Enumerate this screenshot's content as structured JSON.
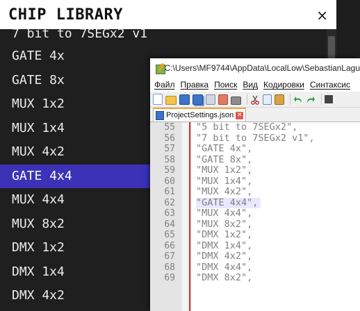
{
  "chip_library": {
    "title": "CHIP LIBRARY",
    "close_symbol": "×",
    "items": [
      {
        "label": "7 bit to 7SEGx2 v1",
        "selected": false
      },
      {
        "label": "GATE 4x",
        "selected": false
      },
      {
        "label": "GATE 8x",
        "selected": false
      },
      {
        "label": "MUX 1x2",
        "selected": false
      },
      {
        "label": "MUX 1x4",
        "selected": false
      },
      {
        "label": "MUX 4x2",
        "selected": false
      },
      {
        "label": "GATE 4x4",
        "selected": true
      },
      {
        "label": "MUX 4x4",
        "selected": false
      },
      {
        "label": "MUX 8x2",
        "selected": false
      },
      {
        "label": "DMX 1x2",
        "selected": false
      },
      {
        "label": "DMX 1x4",
        "selected": false
      },
      {
        "label": "DMX 4x2",
        "selected": false
      }
    ],
    "colors": {
      "selected_bg": "#3b32b8",
      "panel_bg": "#1f1f1f",
      "header_bg": "#ffffff"
    }
  },
  "editor_window": {
    "title": "C:\\Users\\MF9744\\AppData\\LocalLow\\SebastianLagu",
    "menu": [
      "Файл",
      "Правка",
      "Поиск",
      "Вид",
      "Кодировки",
      "Синтаксис"
    ],
    "toolbar_icons": [
      "new-file-icon",
      "open-file-icon",
      "save-icon",
      "save-all-icon",
      "close-icon",
      "close-all-icon",
      "print-icon",
      "cut-icon",
      "copy-icon",
      "paste-icon",
      "undo-icon",
      "redo-icon",
      "find-icon"
    ],
    "tab": {
      "label": "ProjectSettings.json",
      "close": "✕"
    },
    "current_line": 62,
    "lines": [
      {
        "number": "55",
        "text": "\"5 bit to 7SEGx2\","
      },
      {
        "number": "56",
        "text": "\"7 bit to 7SEGx2 v1\","
      },
      {
        "number": "57",
        "text": "\"GATE 4x\","
      },
      {
        "number": "58",
        "text": "\"GATE 8x\","
      },
      {
        "number": "59",
        "text": "\"MUX 1x2\","
      },
      {
        "number": "60",
        "text": "\"MUX 1x4\","
      },
      {
        "number": "61",
        "text": "\"MUX 4x2\","
      },
      {
        "number": "62",
        "text": "\"GATE 4x4\","
      },
      {
        "number": "63",
        "text": "\"MUX 4x4\","
      },
      {
        "number": "64",
        "text": "\"MUX 8x2\","
      },
      {
        "number": "65",
        "text": "\"DMX 1x2\","
      },
      {
        "number": "66",
        "text": "\"DMX 1x4\","
      },
      {
        "number": "67",
        "text": "\"DMX 4x2\","
      },
      {
        "number": "68",
        "text": "\"DMX 4x4\","
      },
      {
        "number": "69",
        "text": "\"DMX 8x2\","
      }
    ],
    "colors": {
      "change_bar": "#e0302a",
      "string_text": "#808080",
      "current_line_bg": "#e8e8ff"
    }
  }
}
